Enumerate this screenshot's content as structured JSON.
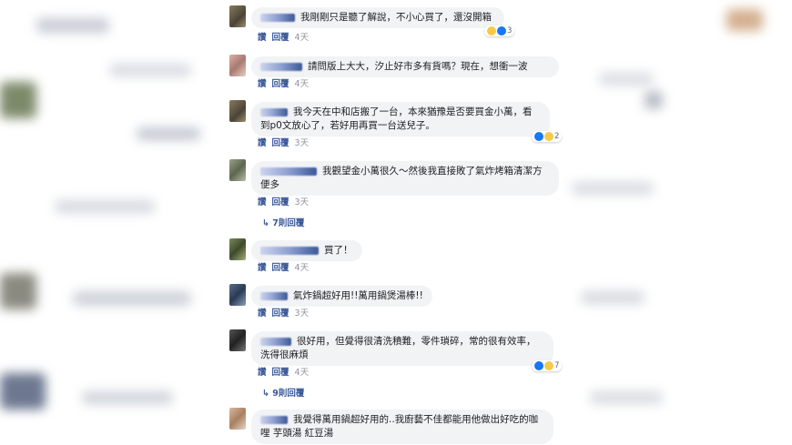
{
  "comments": [
    {
      "text": "我剛剛只是聽了解說，不小心買了，還沒開箱",
      "reply_label": "讚 · 回覆",
      "time": "4天",
      "reaction_count": "3"
    },
    {
      "text": "請問版上大大，汐止好市多有貨嗎？現在，想衝一波",
      "reply_label": "讚 · 回覆",
      "time": "4天"
    },
    {
      "text": "我今天在中和店搬了一台，本來猶豫是否要買金小萬，看到p0文放心了，若好用再買一台送兒子。",
      "reply_label": "讚 · 回覆",
      "time": "3天",
      "reaction_count": "2"
    },
    {
      "text": "我觀望金小萬很久～然後我直接敗了氣炸烤箱清潔方便多",
      "reply_label": "讚 · 回覆",
      "time": "3天",
      "replies": "7則回覆"
    },
    {
      "text": "買了！",
      "reply_label": "讚 · 回覆",
      "time": "4天"
    },
    {
      "text": "氣炸鍋超好用!!萬用鍋煲湯棒!!",
      "reply_label": "讚 · 回覆",
      "time": "3天"
    },
    {
      "text": "很好用，但覺得很清洗積難，零件瑣碎，常的很有效率，洗得很麻煩",
      "reply_label": "讚 · 回覆",
      "time": "4天",
      "reaction_count": "7",
      "replies": "9則回覆"
    },
    {
      "text": "我覺得萬用鍋超好用的..我廚藝不佳都能用他做出好吃的咖哩 芋頭湯 紅豆湯",
      "reply_label": "",
      "time": ""
    }
  ],
  "actions": {
    "like": "讚",
    "reply": "回覆"
  },
  "colors": {
    "link": "#385898",
    "bubble": "#f2f3f5",
    "time": "#90949c"
  }
}
